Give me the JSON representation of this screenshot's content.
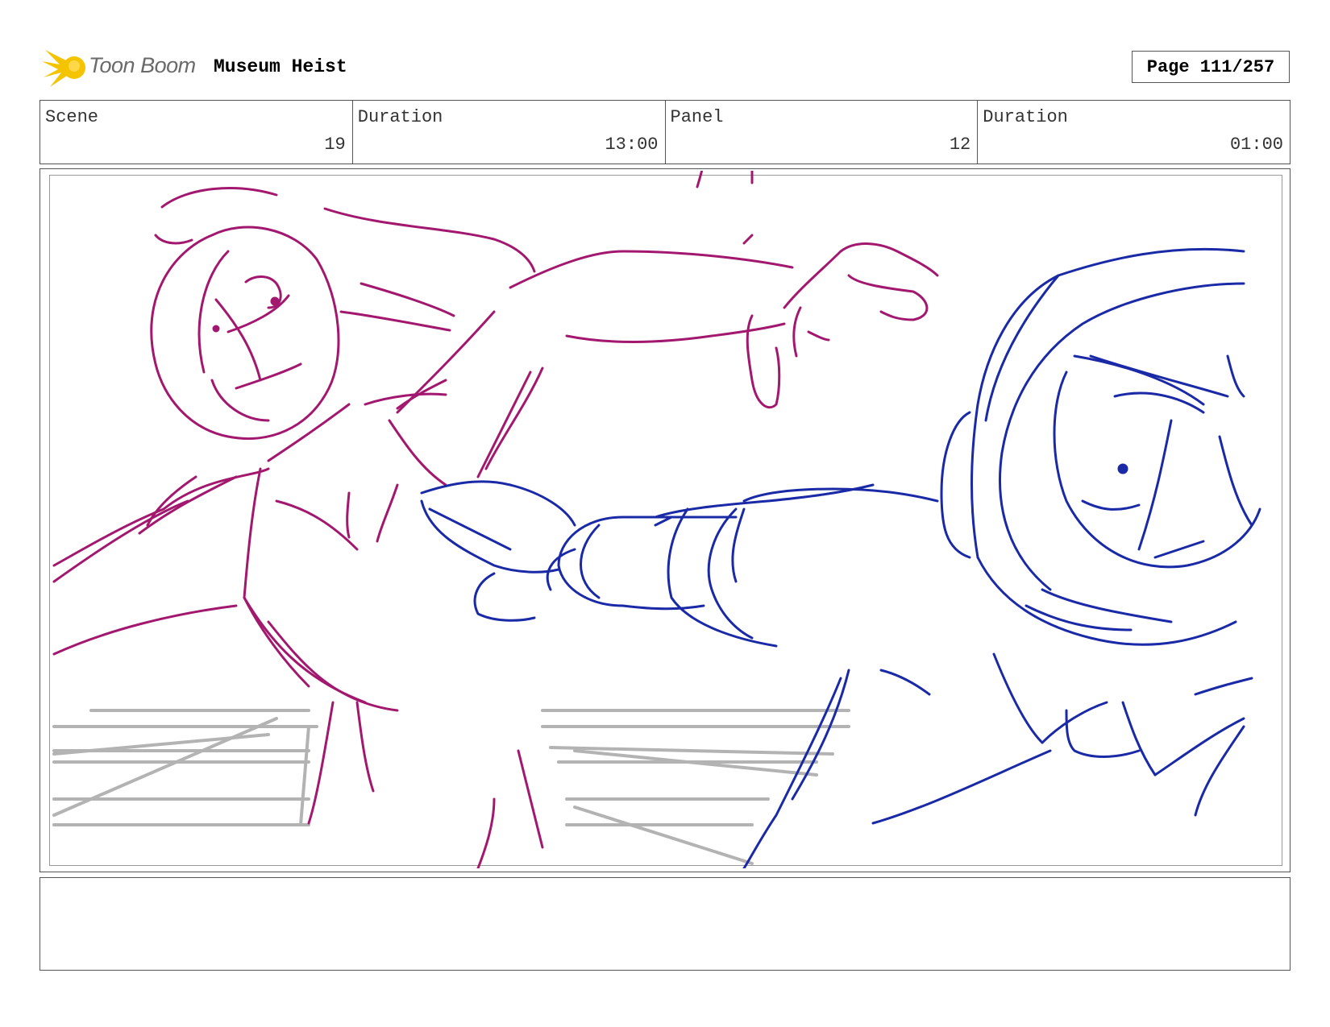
{
  "header": {
    "logo_text": "Toon Boom",
    "project_title": "Museum Heist",
    "page_label": "Page 111/257"
  },
  "info": {
    "scene_label": "Scene",
    "scene_value": "19",
    "scene_duration_label": "Duration",
    "scene_duration_value": "13:00",
    "panel_label": "Panel",
    "panel_value": "12",
    "panel_duration_label": "Duration",
    "panel_duration_value": "01:00"
  },
  "notes": {
    "text": ""
  },
  "colors": {
    "magenta_sketch": "#a3186f",
    "blue_sketch": "#1a2aa6",
    "gray_sketch": "#b3b3b3",
    "logo_yellow": "#f5c400"
  }
}
